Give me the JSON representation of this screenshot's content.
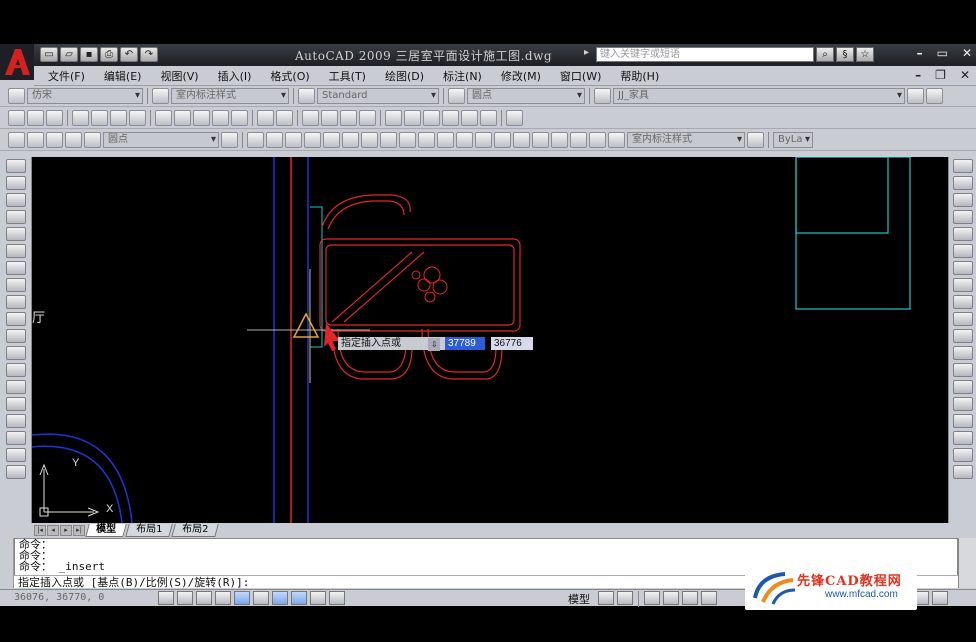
{
  "window": {
    "title": "AutoCAD 2009 三居室平面设计施工图.dwg",
    "search_placeholder": "键入关键字或短语"
  },
  "menu": {
    "items": [
      "文件(F)",
      "编辑(E)",
      "视图(V)",
      "插入(I)",
      "格式(O)",
      "工具(T)",
      "绘图(D)",
      "标注(N)",
      "修改(M)",
      "窗口(W)",
      "帮助(H)"
    ]
  },
  "styles_toolbar": {
    "text_style": "仿宋",
    "dim_style": "室内标注样式",
    "table_style": "Standard",
    "multileader_style": "圆点",
    "layer": "JJ_家具"
  },
  "draw_toolbar": {
    "point_style": "圆点",
    "dim_style2": "室内标注样式",
    "bylayer": "ByLa"
  },
  "canvas": {
    "ucs_x": "X",
    "ucs_y": "Y",
    "prompt_label": "指定插入点或",
    "coord_x": "37789",
    "coord_y": "36776",
    "edge_text": "厅"
  },
  "layout_tabs": [
    "模型",
    "布局1",
    "布局2"
  ],
  "command_history": [
    "命令：",
    "命令：",
    "命令： _insert"
  ],
  "command_prompt": "指定插入点或 [基点(B)/比例(S)/旋转(R)]:",
  "status": {
    "coords": "36076, 36770, 0",
    "model": "模型"
  },
  "watermark": {
    "name": "先锋CAD教程网",
    "url": "www.mfcad.com"
  },
  "colors": {
    "canvas_bg": "#000000",
    "red_lines": "#e0262b",
    "blue_lines": "#2033d8",
    "cyan_lines": "#21c4c4"
  }
}
